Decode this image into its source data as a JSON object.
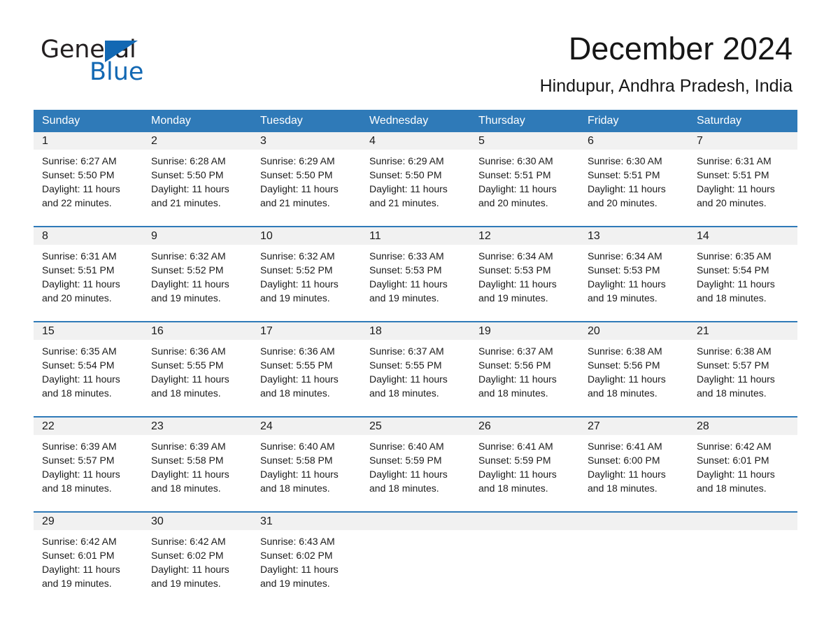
{
  "brand": {
    "name_part1": "General",
    "name_part2": "Blue",
    "accent_color": "#1268b3",
    "triangle_icon": "brand-triangle-icon"
  },
  "header": {
    "month_title": "December 2024",
    "location": "Hindupur, Andhra Pradesh, India"
  },
  "calendar": {
    "header_bg_color": "#2f7ab8",
    "row_divider_color": "#2f7ab8",
    "day_strip_bg_color": "#f1f1f1",
    "weekdays": [
      "Sunday",
      "Monday",
      "Tuesday",
      "Wednesday",
      "Thursday",
      "Friday",
      "Saturday"
    ],
    "weeks": [
      [
        {
          "day": "1",
          "sunrise": "Sunrise: 6:27 AM",
          "sunset": "Sunset: 5:50 PM",
          "daylight_line1": "Daylight: 11 hours",
          "daylight_line2": "and 22 minutes."
        },
        {
          "day": "2",
          "sunrise": "Sunrise: 6:28 AM",
          "sunset": "Sunset: 5:50 PM",
          "daylight_line1": "Daylight: 11 hours",
          "daylight_line2": "and 21 minutes."
        },
        {
          "day": "3",
          "sunrise": "Sunrise: 6:29 AM",
          "sunset": "Sunset: 5:50 PM",
          "daylight_line1": "Daylight: 11 hours",
          "daylight_line2": "and 21 minutes."
        },
        {
          "day": "4",
          "sunrise": "Sunrise: 6:29 AM",
          "sunset": "Sunset: 5:50 PM",
          "daylight_line1": "Daylight: 11 hours",
          "daylight_line2": "and 21 minutes."
        },
        {
          "day": "5",
          "sunrise": "Sunrise: 6:30 AM",
          "sunset": "Sunset: 5:51 PM",
          "daylight_line1": "Daylight: 11 hours",
          "daylight_line2": "and 20 minutes."
        },
        {
          "day": "6",
          "sunrise": "Sunrise: 6:30 AM",
          "sunset": "Sunset: 5:51 PM",
          "daylight_line1": "Daylight: 11 hours",
          "daylight_line2": "and 20 minutes."
        },
        {
          "day": "7",
          "sunrise": "Sunrise: 6:31 AM",
          "sunset": "Sunset: 5:51 PM",
          "daylight_line1": "Daylight: 11 hours",
          "daylight_line2": "and 20 minutes."
        }
      ],
      [
        {
          "day": "8",
          "sunrise": "Sunrise: 6:31 AM",
          "sunset": "Sunset: 5:51 PM",
          "daylight_line1": "Daylight: 11 hours",
          "daylight_line2": "and 20 minutes."
        },
        {
          "day": "9",
          "sunrise": "Sunrise: 6:32 AM",
          "sunset": "Sunset: 5:52 PM",
          "daylight_line1": "Daylight: 11 hours",
          "daylight_line2": "and 19 minutes."
        },
        {
          "day": "10",
          "sunrise": "Sunrise: 6:32 AM",
          "sunset": "Sunset: 5:52 PM",
          "daylight_line1": "Daylight: 11 hours",
          "daylight_line2": "and 19 minutes."
        },
        {
          "day": "11",
          "sunrise": "Sunrise: 6:33 AM",
          "sunset": "Sunset: 5:53 PM",
          "daylight_line1": "Daylight: 11 hours",
          "daylight_line2": "and 19 minutes."
        },
        {
          "day": "12",
          "sunrise": "Sunrise: 6:34 AM",
          "sunset": "Sunset: 5:53 PM",
          "daylight_line1": "Daylight: 11 hours",
          "daylight_line2": "and 19 minutes."
        },
        {
          "day": "13",
          "sunrise": "Sunrise: 6:34 AM",
          "sunset": "Sunset: 5:53 PM",
          "daylight_line1": "Daylight: 11 hours",
          "daylight_line2": "and 19 minutes."
        },
        {
          "day": "14",
          "sunrise": "Sunrise: 6:35 AM",
          "sunset": "Sunset: 5:54 PM",
          "daylight_line1": "Daylight: 11 hours",
          "daylight_line2": "and 18 minutes."
        }
      ],
      [
        {
          "day": "15",
          "sunrise": "Sunrise: 6:35 AM",
          "sunset": "Sunset: 5:54 PM",
          "daylight_line1": "Daylight: 11 hours",
          "daylight_line2": "and 18 minutes."
        },
        {
          "day": "16",
          "sunrise": "Sunrise: 6:36 AM",
          "sunset": "Sunset: 5:55 PM",
          "daylight_line1": "Daylight: 11 hours",
          "daylight_line2": "and 18 minutes."
        },
        {
          "day": "17",
          "sunrise": "Sunrise: 6:36 AM",
          "sunset": "Sunset: 5:55 PM",
          "daylight_line1": "Daylight: 11 hours",
          "daylight_line2": "and 18 minutes."
        },
        {
          "day": "18",
          "sunrise": "Sunrise: 6:37 AM",
          "sunset": "Sunset: 5:55 PM",
          "daylight_line1": "Daylight: 11 hours",
          "daylight_line2": "and 18 minutes."
        },
        {
          "day": "19",
          "sunrise": "Sunrise: 6:37 AM",
          "sunset": "Sunset: 5:56 PM",
          "daylight_line1": "Daylight: 11 hours",
          "daylight_line2": "and 18 minutes."
        },
        {
          "day": "20",
          "sunrise": "Sunrise: 6:38 AM",
          "sunset": "Sunset: 5:56 PM",
          "daylight_line1": "Daylight: 11 hours",
          "daylight_line2": "and 18 minutes."
        },
        {
          "day": "21",
          "sunrise": "Sunrise: 6:38 AM",
          "sunset": "Sunset: 5:57 PM",
          "daylight_line1": "Daylight: 11 hours",
          "daylight_line2": "and 18 minutes."
        }
      ],
      [
        {
          "day": "22",
          "sunrise": "Sunrise: 6:39 AM",
          "sunset": "Sunset: 5:57 PM",
          "daylight_line1": "Daylight: 11 hours",
          "daylight_line2": "and 18 minutes."
        },
        {
          "day": "23",
          "sunrise": "Sunrise: 6:39 AM",
          "sunset": "Sunset: 5:58 PM",
          "daylight_line1": "Daylight: 11 hours",
          "daylight_line2": "and 18 minutes."
        },
        {
          "day": "24",
          "sunrise": "Sunrise: 6:40 AM",
          "sunset": "Sunset: 5:58 PM",
          "daylight_line1": "Daylight: 11 hours",
          "daylight_line2": "and 18 minutes."
        },
        {
          "day": "25",
          "sunrise": "Sunrise: 6:40 AM",
          "sunset": "Sunset: 5:59 PM",
          "daylight_line1": "Daylight: 11 hours",
          "daylight_line2": "and 18 minutes."
        },
        {
          "day": "26",
          "sunrise": "Sunrise: 6:41 AM",
          "sunset": "Sunset: 5:59 PM",
          "daylight_line1": "Daylight: 11 hours",
          "daylight_line2": "and 18 minutes."
        },
        {
          "day": "27",
          "sunrise": "Sunrise: 6:41 AM",
          "sunset": "Sunset: 6:00 PM",
          "daylight_line1": "Daylight: 11 hours",
          "daylight_line2": "and 18 minutes."
        },
        {
          "day": "28",
          "sunrise": "Sunrise: 6:42 AM",
          "sunset": "Sunset: 6:01 PM",
          "daylight_line1": "Daylight: 11 hours",
          "daylight_line2": "and 18 minutes."
        }
      ],
      [
        {
          "day": "29",
          "sunrise": "Sunrise: 6:42 AM",
          "sunset": "Sunset: 6:01 PM",
          "daylight_line1": "Daylight: 11 hours",
          "daylight_line2": "and 19 minutes."
        },
        {
          "day": "30",
          "sunrise": "Sunrise: 6:42 AM",
          "sunset": "Sunset: 6:02 PM",
          "daylight_line1": "Daylight: 11 hours",
          "daylight_line2": "and 19 minutes."
        },
        {
          "day": "31",
          "sunrise": "Sunrise: 6:43 AM",
          "sunset": "Sunset: 6:02 PM",
          "daylight_line1": "Daylight: 11 hours",
          "daylight_line2": "and 19 minutes."
        },
        {
          "day": "",
          "sunrise": "",
          "sunset": "",
          "daylight_line1": "",
          "daylight_line2": ""
        },
        {
          "day": "",
          "sunrise": "",
          "sunset": "",
          "daylight_line1": "",
          "daylight_line2": ""
        },
        {
          "day": "",
          "sunrise": "",
          "sunset": "",
          "daylight_line1": "",
          "daylight_line2": ""
        },
        {
          "day": "",
          "sunrise": "",
          "sunset": "",
          "daylight_line1": "",
          "daylight_line2": ""
        }
      ]
    ]
  }
}
